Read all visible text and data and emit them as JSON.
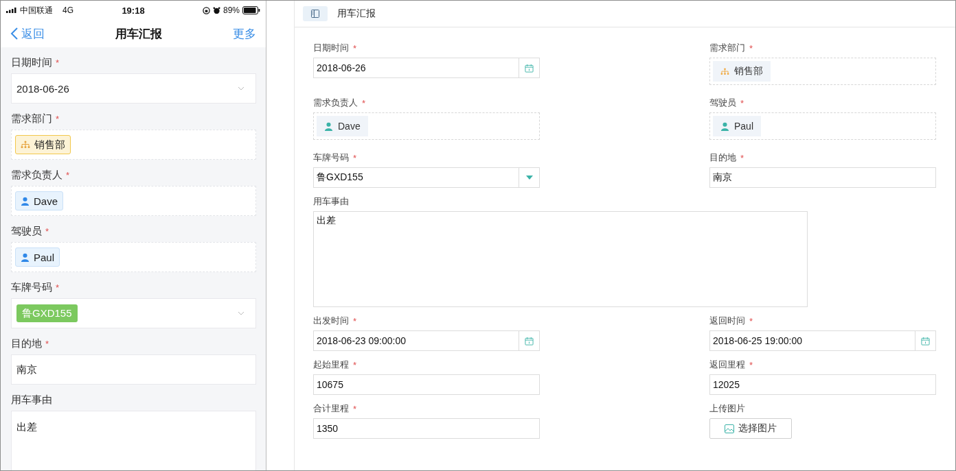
{
  "status_bar": {
    "carrier": "中国联通",
    "network": "4G",
    "time": "19:18",
    "battery": "89%"
  },
  "mobile": {
    "nav": {
      "back": "返回",
      "title": "用车汇报",
      "more": "更多"
    },
    "fields": [
      {
        "kind": "select",
        "label": "日期时间",
        "required_mark": "*",
        "value": "2018-06-26"
      },
      {
        "kind": "dept",
        "label": "需求部门",
        "required_mark": "*",
        "value": "销售部"
      },
      {
        "kind": "person",
        "label": "需求负责人",
        "required_mark": "*",
        "value": "Dave"
      },
      {
        "kind": "person",
        "label": "驾驶员",
        "required_mark": "*",
        "value": "Paul"
      },
      {
        "kind": "plate",
        "label": "车牌号码",
        "required_mark": "*",
        "value": "鲁GXD155"
      },
      {
        "kind": "text",
        "label": "目的地",
        "required_mark": "*",
        "value": "南京"
      },
      {
        "kind": "textarea",
        "label": "用车事由",
        "value": "出差"
      }
    ]
  },
  "desktop": {
    "title": "用车汇报",
    "rows": [
      [
        {
          "kind": "date",
          "label": "日期时间",
          "required_mark": "*",
          "value": "2018-06-26"
        },
        {
          "kind": "dept",
          "label": "需求部门",
          "required_mark": "*",
          "value": "销售部"
        }
      ],
      [
        {
          "kind": "person",
          "label": "需求负责人",
          "required_mark": "*",
          "value": "Dave"
        },
        {
          "kind": "person",
          "label": "驾驶员",
          "required_mark": "*",
          "value": "Paul"
        }
      ],
      [
        {
          "kind": "select",
          "label": "车牌号码",
          "required_mark": "*",
          "value": "鲁GXD155"
        },
        {
          "kind": "text",
          "label": "目的地",
          "required_mark": "*",
          "value": "南京"
        }
      ],
      [
        {
          "kind": "textarea",
          "label": "用车事由",
          "value": "出差"
        }
      ],
      [
        {
          "kind": "date",
          "label": "出发时间",
          "required_mark": "*",
          "value": "2018-06-23 09:00:00"
        },
        {
          "kind": "date",
          "label": "返回时间",
          "required_mark": "*",
          "value": "2018-06-25 19:00:00"
        }
      ],
      [
        {
          "kind": "text",
          "label": "起始里程",
          "required_mark": "*",
          "value": "10675"
        },
        {
          "kind": "text",
          "label": "返回里程",
          "required_mark": "*",
          "value": "12025"
        }
      ],
      [
        {
          "kind": "text",
          "label": "合计里程",
          "required_mark": "*",
          "value": "1350"
        },
        {
          "kind": "upload",
          "label": "上传图片",
          "value": "选择图片"
        }
      ]
    ]
  }
}
